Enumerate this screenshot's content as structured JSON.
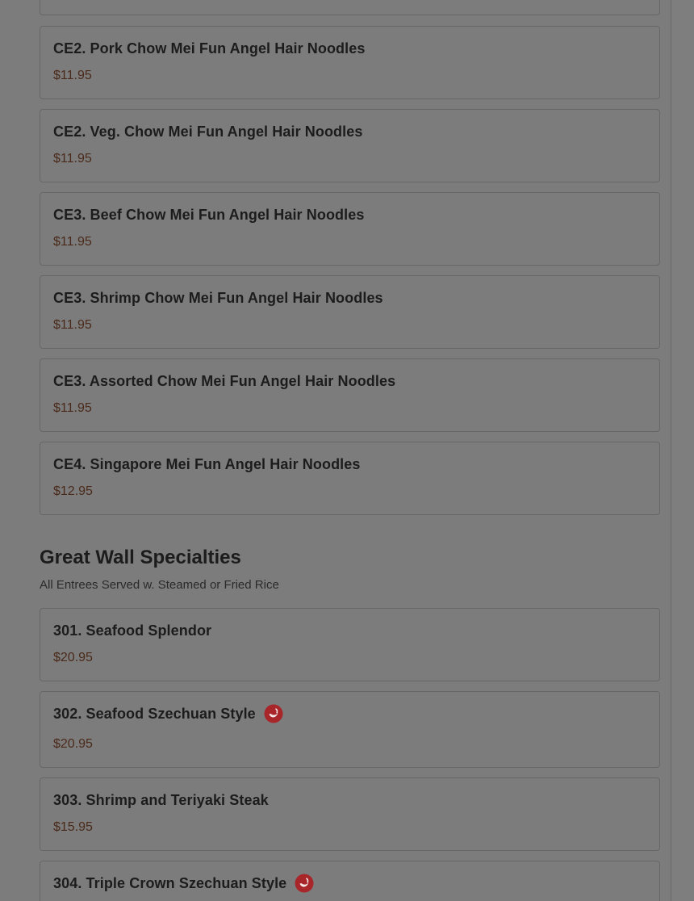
{
  "sections": [
    {
      "items": [
        {
          "name": "CE2. Pork Chow Mei Fun Angel Hair Noodles",
          "price": "$11.95"
        },
        {
          "name": "CE2. Veg. Chow Mei Fun Angel Hair Noodles",
          "price": "$11.95"
        },
        {
          "name": "CE3. Beef Chow Mei Fun Angel Hair Noodles",
          "price": "$11.95"
        },
        {
          "name": "CE3. Shrimp Chow Mei Fun Angel Hair Noodles",
          "price": "$11.95"
        },
        {
          "name": "CE3. Assorted Chow Mei Fun Angel Hair Noodles",
          "price": "$11.95"
        },
        {
          "name": "CE4. Singapore Mei Fun Angel Hair Noodles",
          "price": "$12.95"
        }
      ]
    },
    {
      "title": "Great Wall Specialties",
      "subtitle": "All Entrees Served w. Steamed or Fried Rice",
      "items": [
        {
          "name": "301. Seafood Splendor",
          "price": "$20.95"
        },
        {
          "name": "302. Seafood Szechuan Style",
          "price": "$20.95",
          "icon": "spicy-pepper-icon"
        },
        {
          "name": "303. Shrimp and Teriyaki Steak",
          "price": "$15.95"
        },
        {
          "name": "304. Triple Crown Szechuan Style",
          "price": "",
          "icon": "spicy-pepper-icon"
        }
      ]
    }
  ],
  "colors": {
    "overlay": "#7c7c7c",
    "price": "#4a2a1a",
    "spicy_icon": "#b01818"
  }
}
